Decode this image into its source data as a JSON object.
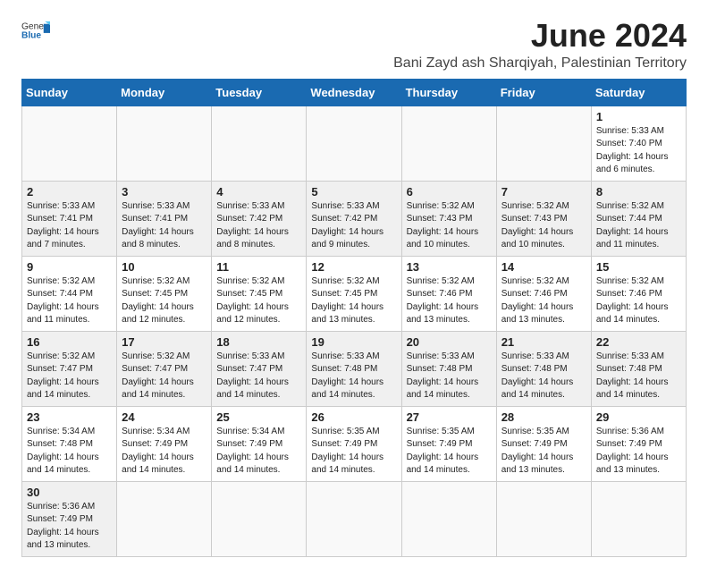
{
  "header": {
    "logo_general": "General",
    "logo_blue": "Blue",
    "month": "June 2024",
    "location": "Bani Zayd ash Sharqiyah, Palestinian Territory"
  },
  "weekdays": [
    "Sunday",
    "Monday",
    "Tuesday",
    "Wednesday",
    "Thursday",
    "Friday",
    "Saturday"
  ],
  "weeks": [
    [
      {
        "day": "",
        "info": ""
      },
      {
        "day": "",
        "info": ""
      },
      {
        "day": "",
        "info": ""
      },
      {
        "day": "",
        "info": ""
      },
      {
        "day": "",
        "info": ""
      },
      {
        "day": "",
        "info": ""
      },
      {
        "day": "1",
        "info": "Sunrise: 5:33 AM\nSunset: 7:40 PM\nDaylight: 14 hours\nand 6 minutes."
      }
    ],
    [
      {
        "day": "2",
        "info": "Sunrise: 5:33 AM\nSunset: 7:41 PM\nDaylight: 14 hours\nand 7 minutes."
      },
      {
        "day": "3",
        "info": "Sunrise: 5:33 AM\nSunset: 7:41 PM\nDaylight: 14 hours\nand 8 minutes."
      },
      {
        "day": "4",
        "info": "Sunrise: 5:33 AM\nSunset: 7:42 PM\nDaylight: 14 hours\nand 8 minutes."
      },
      {
        "day": "5",
        "info": "Sunrise: 5:33 AM\nSunset: 7:42 PM\nDaylight: 14 hours\nand 9 minutes."
      },
      {
        "day": "6",
        "info": "Sunrise: 5:32 AM\nSunset: 7:43 PM\nDaylight: 14 hours\nand 10 minutes."
      },
      {
        "day": "7",
        "info": "Sunrise: 5:32 AM\nSunset: 7:43 PM\nDaylight: 14 hours\nand 10 minutes."
      },
      {
        "day": "8",
        "info": "Sunrise: 5:32 AM\nSunset: 7:44 PM\nDaylight: 14 hours\nand 11 minutes."
      }
    ],
    [
      {
        "day": "9",
        "info": "Sunrise: 5:32 AM\nSunset: 7:44 PM\nDaylight: 14 hours\nand 11 minutes."
      },
      {
        "day": "10",
        "info": "Sunrise: 5:32 AM\nSunset: 7:45 PM\nDaylight: 14 hours\nand 12 minutes."
      },
      {
        "day": "11",
        "info": "Sunrise: 5:32 AM\nSunset: 7:45 PM\nDaylight: 14 hours\nand 12 minutes."
      },
      {
        "day": "12",
        "info": "Sunrise: 5:32 AM\nSunset: 7:45 PM\nDaylight: 14 hours\nand 13 minutes."
      },
      {
        "day": "13",
        "info": "Sunrise: 5:32 AM\nSunset: 7:46 PM\nDaylight: 14 hours\nand 13 minutes."
      },
      {
        "day": "14",
        "info": "Sunrise: 5:32 AM\nSunset: 7:46 PM\nDaylight: 14 hours\nand 13 minutes."
      },
      {
        "day": "15",
        "info": "Sunrise: 5:32 AM\nSunset: 7:46 PM\nDaylight: 14 hours\nand 14 minutes."
      }
    ],
    [
      {
        "day": "16",
        "info": "Sunrise: 5:32 AM\nSunset: 7:47 PM\nDaylight: 14 hours\nand 14 minutes."
      },
      {
        "day": "17",
        "info": "Sunrise: 5:32 AM\nSunset: 7:47 PM\nDaylight: 14 hours\nand 14 minutes."
      },
      {
        "day": "18",
        "info": "Sunrise: 5:33 AM\nSunset: 7:47 PM\nDaylight: 14 hours\nand 14 minutes."
      },
      {
        "day": "19",
        "info": "Sunrise: 5:33 AM\nSunset: 7:48 PM\nDaylight: 14 hours\nand 14 minutes."
      },
      {
        "day": "20",
        "info": "Sunrise: 5:33 AM\nSunset: 7:48 PM\nDaylight: 14 hours\nand 14 minutes."
      },
      {
        "day": "21",
        "info": "Sunrise: 5:33 AM\nSunset: 7:48 PM\nDaylight: 14 hours\nand 14 minutes."
      },
      {
        "day": "22",
        "info": "Sunrise: 5:33 AM\nSunset: 7:48 PM\nDaylight: 14 hours\nand 14 minutes."
      }
    ],
    [
      {
        "day": "23",
        "info": "Sunrise: 5:34 AM\nSunset: 7:48 PM\nDaylight: 14 hours\nand 14 minutes."
      },
      {
        "day": "24",
        "info": "Sunrise: 5:34 AM\nSunset: 7:49 PM\nDaylight: 14 hours\nand 14 minutes."
      },
      {
        "day": "25",
        "info": "Sunrise: 5:34 AM\nSunset: 7:49 PM\nDaylight: 14 hours\nand 14 minutes."
      },
      {
        "day": "26",
        "info": "Sunrise: 5:35 AM\nSunset: 7:49 PM\nDaylight: 14 hours\nand 14 minutes."
      },
      {
        "day": "27",
        "info": "Sunrise: 5:35 AM\nSunset: 7:49 PM\nDaylight: 14 hours\nand 14 minutes."
      },
      {
        "day": "28",
        "info": "Sunrise: 5:35 AM\nSunset: 7:49 PM\nDaylight: 14 hours\nand 13 minutes."
      },
      {
        "day": "29",
        "info": "Sunrise: 5:36 AM\nSunset: 7:49 PM\nDaylight: 14 hours\nand 13 minutes."
      }
    ],
    [
      {
        "day": "30",
        "info": "Sunrise: 5:36 AM\nSunset: 7:49 PM\nDaylight: 14 hours\nand 13 minutes."
      },
      {
        "day": "",
        "info": ""
      },
      {
        "day": "",
        "info": ""
      },
      {
        "day": "",
        "info": ""
      },
      {
        "day": "",
        "info": ""
      },
      {
        "day": "",
        "info": ""
      },
      {
        "day": "",
        "info": ""
      }
    ]
  ]
}
